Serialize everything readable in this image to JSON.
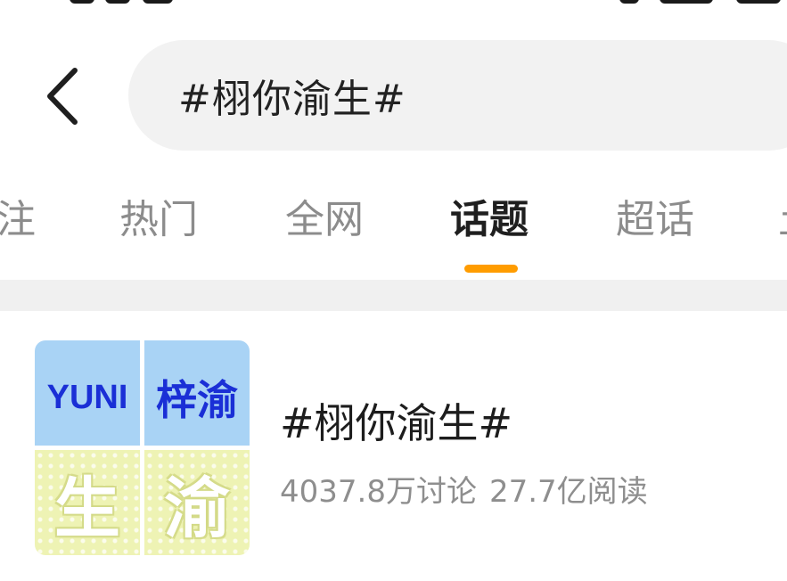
{
  "search": {
    "query": "#栩你渝生#"
  },
  "tabs": [
    {
      "label": "注"
    },
    {
      "label": "热门"
    },
    {
      "label": "全网"
    },
    {
      "label": "话题"
    },
    {
      "label": "超话"
    },
    {
      "label": "土"
    }
  ],
  "active_tab": "话题",
  "accent_color": "#ff9c00",
  "result": {
    "title": "#栩你渝生#",
    "discussions": "4037.8万讨论",
    "reads": "27.7亿阅读",
    "thumbnail": {
      "top_left": "YUNI",
      "top_right": "梓渝",
      "bottom_left": "生",
      "bottom_right": "渝"
    }
  }
}
